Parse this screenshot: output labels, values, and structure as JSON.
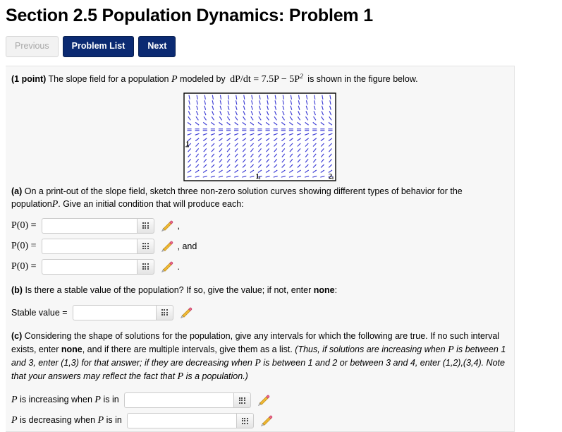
{
  "header": {
    "title": "Section 2.5 Population Dynamics: Problem 1"
  },
  "nav": {
    "previous_label": "Previous",
    "problem_list_label": "Problem List",
    "next_label": "Next"
  },
  "intro": {
    "points": "(1 point)",
    "text_before": "The slope field for a population",
    "var_p": "P",
    "text_mid": "modeled by",
    "equation": "dP/dt = 7.5P − 5P",
    "equation_exponent": "2",
    "text_after": "is shown in the figure below."
  },
  "figure": {
    "name": "slope-field-plot",
    "x_ticks": [
      "1",
      "2"
    ],
    "y_ticks": [
      "1"
    ],
    "equilibrium_value": 1.5,
    "x_range": [
      0,
      2
    ],
    "y_range": [
      0,
      2.6
    ],
    "slope_color": "#3b3bd4",
    "frame_color": "#000000",
    "background": "#ffffff"
  },
  "part_a": {
    "marker": "(a)",
    "line1_before": "On a print-out of the slope field, sketch three non-zero solution curves showing different types of behavior for the population",
    "var_p": "P",
    "line1_after": ".",
    "line2": "Give an initial condition that will produce each:",
    "rows": [
      {
        "label": "P(0) =",
        "value": "",
        "trail": ","
      },
      {
        "label": "P(0) =",
        "value": "",
        "trail": ", and"
      },
      {
        "label": "P(0) =",
        "value": "",
        "trail": "."
      }
    ]
  },
  "part_b": {
    "marker": "(b)",
    "text_before": "Is there a stable value of the population? If so, give the value; if not, enter",
    "bold_word": "none",
    "text_after": ":",
    "row": {
      "label": "Stable value =",
      "value": ""
    }
  },
  "part_c": {
    "marker": "(c)",
    "seg1": "Considering the shape of solutions for the population, give any intervals for which the following are true. If no such interval exists, enter",
    "bold_word": "none",
    "seg2": ", and if there are multiple intervals, give them as a list.",
    "italic1": "(Thus, if solutions are increasing when",
    "var_p": "P",
    "italic2": "is between 1 and 3, enter (1,3) for that answer; if they are decreasing when",
    "italic3": "is between 1 and 2 or between 3 and 4, enter (1,2),(3,4). Note that your answers may reflect the fact that",
    "italic4": "is a population.)",
    "rows": [
      {
        "label_pre": "P",
        "label_mid": "is increasing when",
        "label_var": "P",
        "label_post": "is in",
        "value": ""
      },
      {
        "label_pre": "P",
        "label_mid": "is decreasing when",
        "label_var": "P",
        "label_post": "is in",
        "value": ""
      }
    ]
  },
  "icons": {
    "grid": "grid-icon",
    "pencil": "pencil-icon"
  },
  "colors": {
    "primary_button": "#0b2a72",
    "panel_bg": "#f7f7f7",
    "slope": "#3b3bd4"
  }
}
